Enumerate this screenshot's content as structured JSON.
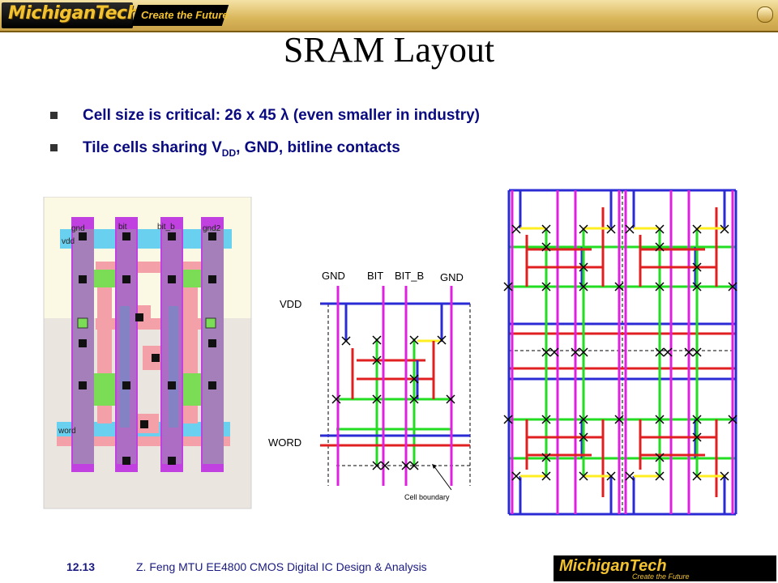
{
  "header": {
    "logo": "MichiganTech",
    "tagline": "Create the Future"
  },
  "title": "SRAM Layout",
  "bullets": [
    {
      "text": "Cell size is critical: 26 x 45 λ (even smaller in industry)"
    },
    {
      "text_pre": "Tile cells sharing V",
      "sub": "DD",
      "text_post": ", GND, bitline contacts"
    }
  ],
  "layout_labels": {
    "gnd": "gnd",
    "bit": "bit",
    "bit_b": "bit_b",
    "gnd2": "gnd2",
    "vdd": "vdd",
    "word": "word"
  },
  "stick_labels": {
    "gnd": "GND",
    "bit": "BIT",
    "bit_b": "BIT_B",
    "gnd2": "GND",
    "vdd": "VDD",
    "word": "WORD",
    "boundary": "Cell boundary"
  },
  "footer": {
    "slide_number": "12.13",
    "credit": "Z. Feng  MTU EE4800 CMOS Digital IC Design & Analysis",
    "logo": "MichiganTech",
    "tagline": "Create the Future"
  },
  "colors": {
    "metal1": "#2b2bd6",
    "metal2": "#e020e0",
    "poly": "#e02020",
    "diffusion": "#22dd22",
    "contact": "#000000",
    "yellow": "#ffee22"
  }
}
